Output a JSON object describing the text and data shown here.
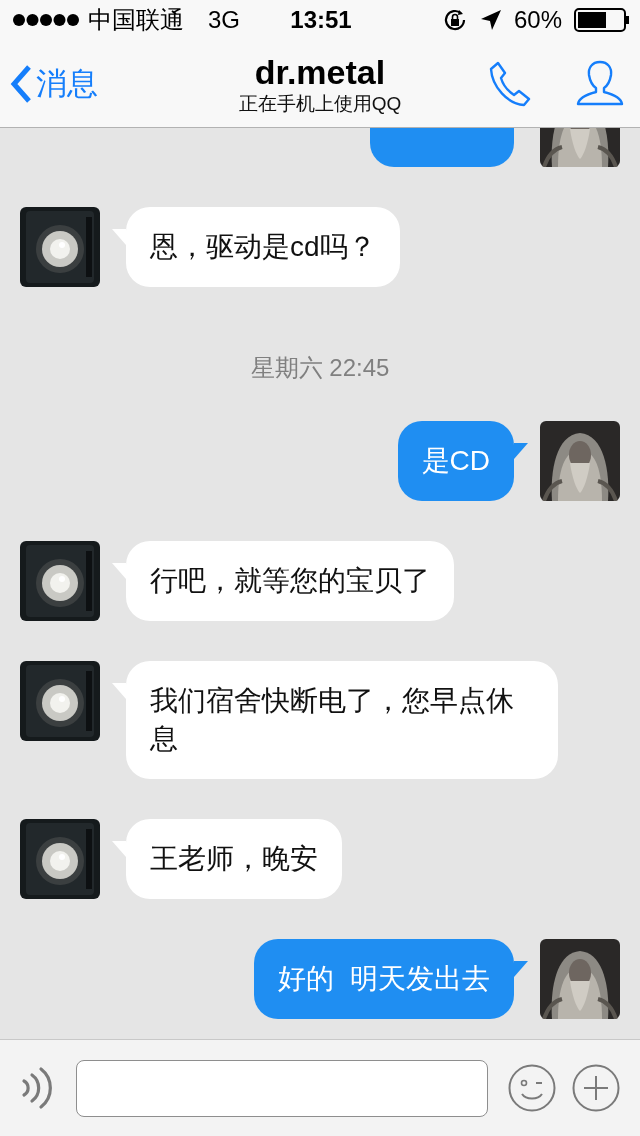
{
  "status_bar": {
    "carrier": "中国联通",
    "network": "3G",
    "time": "13:51",
    "battery": "60%"
  },
  "nav": {
    "back": "消息",
    "title": "dr.metal",
    "subtitle": "正在手机上使用QQ"
  },
  "messages": [
    {
      "kind": "clipped_message",
      "outgoing": true
    },
    {
      "kind": "message",
      "outgoing": false,
      "text": "恩，驱动是cd吗？"
    },
    {
      "kind": "timestamp",
      "text": "星期六 22:45"
    },
    {
      "kind": "message",
      "outgoing": true,
      "text": "是CD"
    },
    {
      "kind": "message",
      "outgoing": false,
      "text": "行吧，就等您的宝贝了"
    },
    {
      "kind": "message",
      "outgoing": false,
      "text": "我们宿舍快断电了，您早点休息"
    },
    {
      "kind": "message",
      "outgoing": false,
      "text": "王老师，晚安"
    },
    {
      "kind": "message",
      "outgoing": true,
      "text": "好的  明天发出去"
    }
  ]
}
